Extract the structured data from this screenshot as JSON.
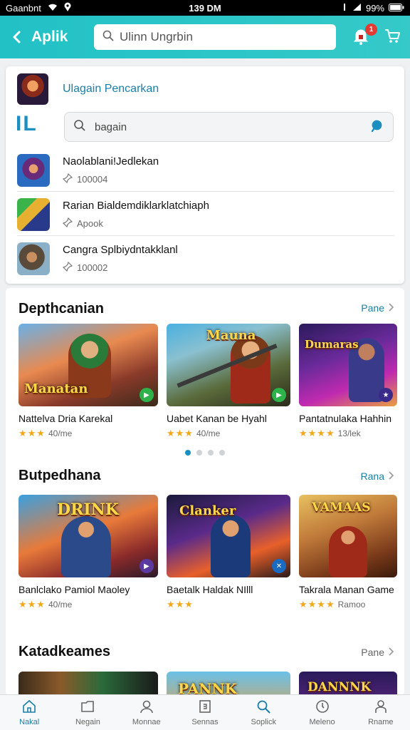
{
  "status_bar": {
    "carrier": "Gaanbnt",
    "time": "139 DM",
    "battery": "99%"
  },
  "app_bar": {
    "title": "Aplik",
    "search_placeholder": "Ulinn Ungrbin",
    "notification_count": "1"
  },
  "dropdown": {
    "header_title": "Ulagain Pencarkan",
    "logo_text": "IL",
    "search_value": "bagain",
    "suggestions": [
      {
        "name": "Naolablani!Jedlekan",
        "meta": "100004"
      },
      {
        "name": "Rarian Bialdemdiklarklatchiaph",
        "meta": "Apook"
      },
      {
        "name": "Cangra Splbiydntakklanl",
        "meta": "100002"
      }
    ]
  },
  "sections": [
    {
      "title": "Depthcanian",
      "see_all": "Pane",
      "cards": [
        {
          "name": "Nattelva Dria Karekal",
          "rating": "40/me",
          "stars": "★★★",
          "art_label": "Manatan"
        },
        {
          "name": "Uabet Kanan be Hyahl",
          "rating": "40/me",
          "stars": "★★★",
          "art_label": "Mauna"
        },
        {
          "name": "Pantatnulaka Hahhin",
          "rating": "13/lek",
          "stars": "★★★★",
          "art_label": "Dumaras"
        }
      ],
      "carousel_pages": 4,
      "carousel_active": 1
    },
    {
      "title": "Butpedhana",
      "see_all": "Rana",
      "cards": [
        {
          "name": "Banlclako Pamiol Maoley",
          "rating": "40/me",
          "stars": "★★★",
          "art_label": "DRINK"
        },
        {
          "name": "Baetalk Haldak NIlll",
          "rating": "",
          "stars": "★★★",
          "art_label": "Clanker"
        },
        {
          "name": "Takrala Manan Game",
          "rating": "Ramoo",
          "stars": "★★★★",
          "art_label": "VAMAAS"
        }
      ]
    },
    {
      "title": "Katadkeames",
      "see_all": "Pane",
      "cards": [
        {
          "art_label": ""
        },
        {
          "art_label": "PANNK"
        },
        {
          "art_label": "DANNNK"
        }
      ]
    }
  ],
  "bottom_nav": [
    {
      "label": "Nakal",
      "icon": "home-icon",
      "active": true
    },
    {
      "label": "Negain",
      "icon": "folder-icon",
      "active": false
    },
    {
      "label": "Monnae",
      "icon": "person-icon",
      "active": false
    },
    {
      "label": "Sennas",
      "icon": "doc-icon",
      "active": false
    },
    {
      "label": "Soplick",
      "icon": "search-icon",
      "active": false
    },
    {
      "label": "Meleno",
      "icon": "clock-icon",
      "active": false
    },
    {
      "label": "Rname",
      "icon": "profile-icon",
      "active": false
    }
  ],
  "colors": {
    "accent": "#22c1c6",
    "link": "#1a7fa8",
    "badge": "#e53935",
    "star": "#f2a81d"
  }
}
